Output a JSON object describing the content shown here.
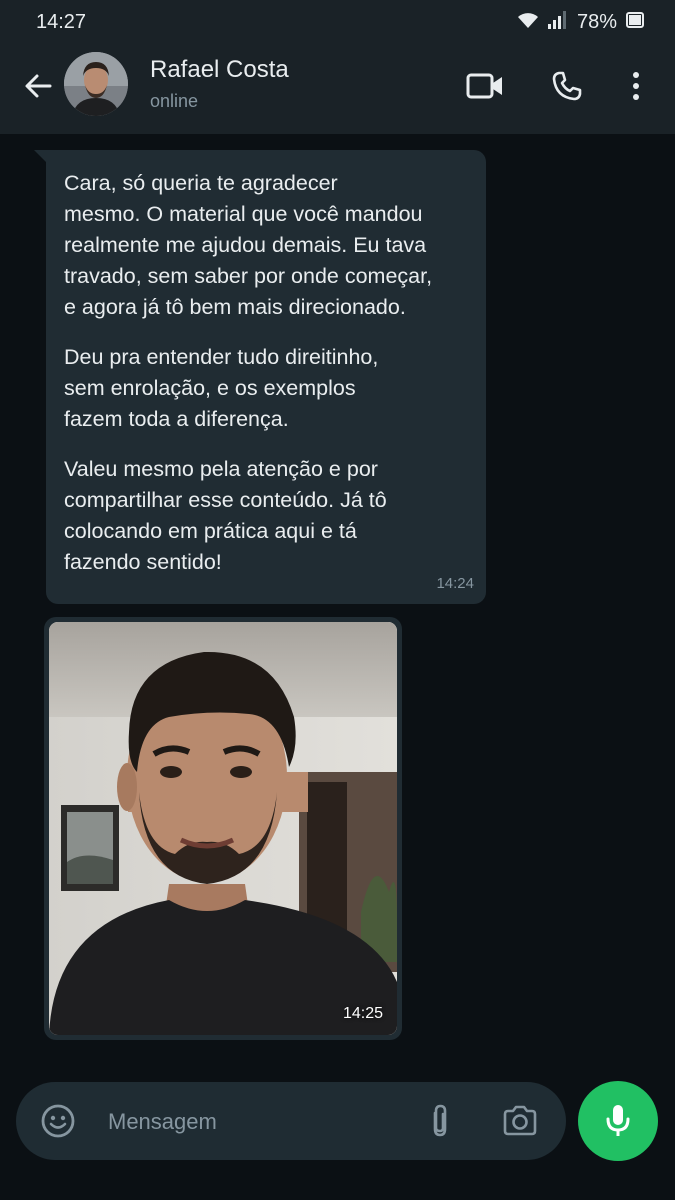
{
  "status_bar": {
    "time": "14:27",
    "battery": "78%",
    "icons": [
      "wifi-icon",
      "signal-icon",
      "battery-icon"
    ]
  },
  "header": {
    "contact_name": "Rafael Costa",
    "contact_status": "online",
    "icons": [
      "back-arrow-icon",
      "video-call-icon",
      "phone-icon",
      "more-vert-icon"
    ]
  },
  "messages": [
    {
      "type": "text",
      "paragraphs": [
        "Cara, só queria te agradecer\nmesmo. O material que você mandou\nrealmente me ajudou demais. Eu tava\ntravado, sem saber por onde começar,\ne agora já tô bem mais direcionado.",
        "Deu pra entender tudo direitinho,\nsem enrolação, e os exemplos\nfazem toda a diferença.",
        "Valeu mesmo pela atenção e por\ncompartilhar esse conteúdo. Já tô\ncolocando em prática aqui e tá\nfazendo sentido!"
      ],
      "time": "14:24"
    },
    {
      "type": "image",
      "time": "14:25"
    }
  ],
  "composer": {
    "placeholder": "Mensagem",
    "icons": [
      "emoji-icon",
      "attach-icon",
      "camera-icon",
      "mic-icon"
    ]
  },
  "colors": {
    "background": "#0b1014",
    "header": "#1a2227",
    "incoming_bubble": "#202c33",
    "accent_green": "#21c063",
    "secondary_text": "#8696a0"
  }
}
